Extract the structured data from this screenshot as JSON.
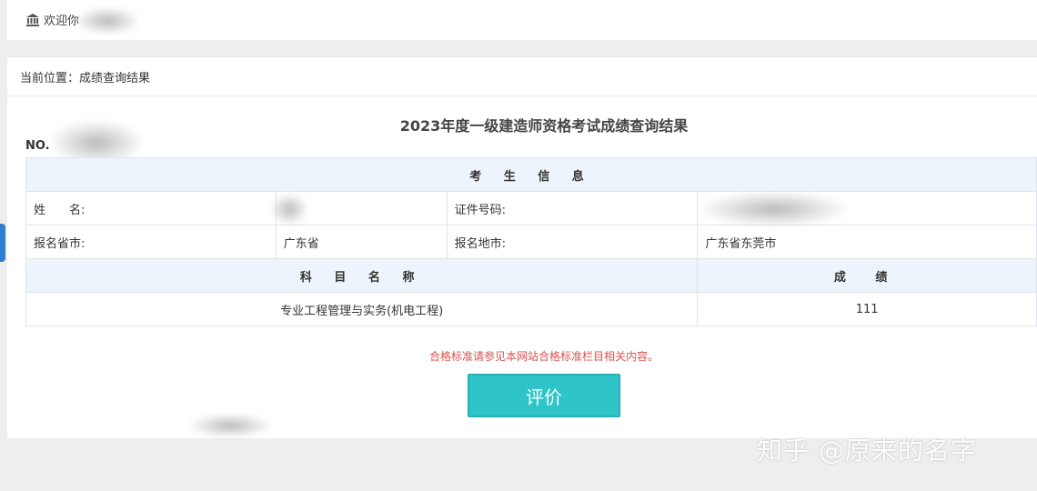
{
  "header": {
    "welcome_text": "欢迎你"
  },
  "breadcrumb": {
    "text": "当前位置：成绩查询结果"
  },
  "result": {
    "title": "2023年度一级建造师资格考试成绩查询结果",
    "no_label": "NO.",
    "section_header": "考 生 信 息",
    "name_label": "姓　　名:",
    "name_value": "",
    "id_label": "证件号码:",
    "id_value": "",
    "province_label": "报名省市:",
    "province_value": "广东省",
    "location_label": "报名地市:",
    "location_value": "广东省东莞市",
    "subject_header": "科 目 名 称",
    "score_header": "成 绩",
    "subjects": [
      {
        "name": "专业工程管理与实务(机电工程)",
        "score": "111"
      }
    ]
  },
  "notice": "合格标准请参见本网站合格标准栏目相关内容。",
  "actions": {
    "rate_label": "评价"
  },
  "watermark": "知乎 @原来的名字",
  "colors": {
    "accent_button": "#2fc4c8",
    "notice_red": "#d9534f",
    "table_header_bg": "#eef4fb"
  }
}
